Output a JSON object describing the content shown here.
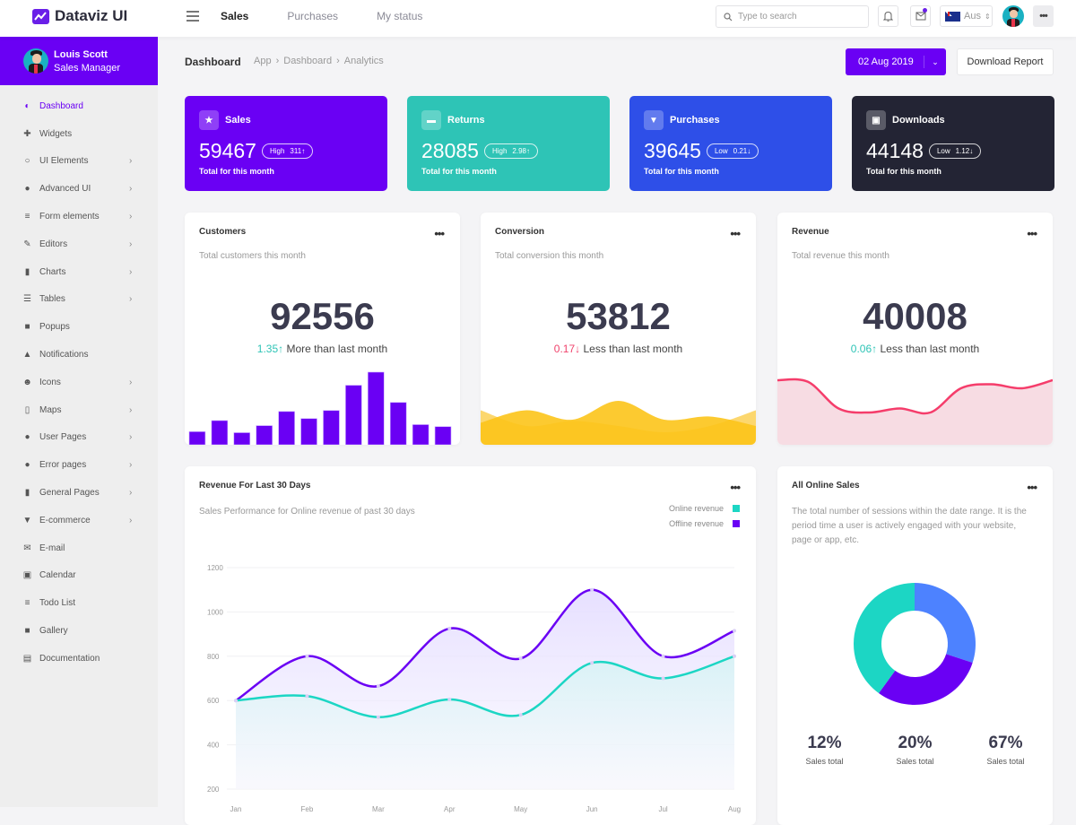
{
  "app": {
    "name": "Dataviz UI"
  },
  "topnav": {
    "tabs": [
      {
        "label": "Sales",
        "active": true
      },
      {
        "label": "Purchases"
      },
      {
        "label": "My status"
      }
    ],
    "search_placeholder": "Type to search",
    "language": "Aus",
    "notification_dot_color": "#6a1fe8"
  },
  "user": {
    "name": "Louis Scott",
    "role": "Sales Manager"
  },
  "sidebar": {
    "items": [
      {
        "label": "Dashboard",
        "icon": "shield-icon",
        "glyph": "◐",
        "active": true,
        "chevron": false
      },
      {
        "label": "Widgets",
        "icon": "puzzle-icon",
        "glyph": "✚",
        "chevron": false
      },
      {
        "label": "UI Elements",
        "icon": "circle-icon",
        "glyph": "○",
        "chevron": true
      },
      {
        "label": "Advanced UI",
        "icon": "palette-icon",
        "glyph": "●",
        "chevron": true
      },
      {
        "label": "Form elements",
        "icon": "list-icon",
        "glyph": "≡",
        "chevron": true
      },
      {
        "label": "Editors",
        "icon": "pencil-icon",
        "glyph": "✎",
        "chevron": true
      },
      {
        "label": "Charts",
        "icon": "bar-chart-icon",
        "glyph": "▮",
        "chevron": true
      },
      {
        "label": "Tables",
        "icon": "table-icon",
        "glyph": "☰",
        "chevron": true
      },
      {
        "label": "Popups",
        "icon": "comment-icon",
        "glyph": "■",
        "chevron": false
      },
      {
        "label": "Notifications",
        "icon": "bell-icon",
        "glyph": "▲",
        "chevron": false
      },
      {
        "label": "Icons",
        "icon": "smiley-icon",
        "glyph": "☻",
        "chevron": true
      },
      {
        "label": "Maps",
        "icon": "map-icon",
        "glyph": "▯",
        "chevron": true
      },
      {
        "label": "User Pages",
        "icon": "user-circle-icon",
        "glyph": "●",
        "chevron": true
      },
      {
        "label": "Error pages",
        "icon": "alert-icon",
        "glyph": "●",
        "chevron": true
      },
      {
        "label": "General Pages",
        "icon": "file-icon",
        "glyph": "▮",
        "chevron": true
      },
      {
        "label": "E-commerce",
        "icon": "basket-icon",
        "glyph": "▼",
        "chevron": true
      },
      {
        "label": "E-mail",
        "icon": "mail-icon",
        "glyph": "✉",
        "chevron": false
      },
      {
        "label": "Calendar",
        "icon": "calendar-icon",
        "glyph": "▣",
        "chevron": false
      },
      {
        "label": "Todo List",
        "icon": "checklist-icon",
        "glyph": "≡",
        "chevron": false
      },
      {
        "label": "Gallery",
        "icon": "image-icon",
        "glyph": "■",
        "chevron": false
      },
      {
        "label": "Documentation",
        "icon": "document-icon",
        "glyph": "▤",
        "chevron": false
      }
    ]
  },
  "header": {
    "title": "Dashboard",
    "breadcrumb": [
      "App",
      "Dashboard",
      "Analytics"
    ],
    "date": "02 Aug 2019",
    "download_label": "Download Report"
  },
  "stats": [
    {
      "label": "Sales",
      "value": "59467",
      "level": "High",
      "change": "311",
      "dir": "↑",
      "sub": "Total for this month",
      "color": "#6a00f4",
      "icon": "star-icon"
    },
    {
      "label": "Returns",
      "value": "28085",
      "level": "High",
      "change": "2.98",
      "dir": "↑",
      "sub": "Total for this month",
      "color": "#2ec4b6",
      "icon": "truck-icon"
    },
    {
      "label": "Purchases",
      "value": "39645",
      "level": "Low",
      "change": "0.21",
      "dir": "↓",
      "sub": "Total for this month",
      "color": "#2e4fe8",
      "icon": "basket-icon"
    },
    {
      "label": "Downloads",
      "value": "44148",
      "level": "Low",
      "change": "1.12",
      "dir": "↓",
      "sub": "Total for this month",
      "color": "#232434",
      "icon": "archive-icon"
    }
  ],
  "kpis": [
    {
      "title": "Customers",
      "subtitle": "Total customers this month",
      "value": "92556",
      "delta": "1.35",
      "dir": "↑",
      "trend": "up",
      "note": "More than last month"
    },
    {
      "title": "Conversion",
      "subtitle": "Total conversion this month",
      "value": "53812",
      "delta": "0.17",
      "dir": "↓",
      "trend": "down",
      "note": "Less than last month"
    },
    {
      "title": "Revenue",
      "subtitle": "Total revenue this month",
      "value": "40008",
      "delta": "0.06",
      "dir": "↑",
      "trend": "up",
      "note": "Less than last month"
    }
  ],
  "revenue_card": {
    "title": "Revenue For Last 30 Days",
    "subtitle": "Sales Performance for Online revenue of past 30 days"
  },
  "online_sales": {
    "title": "All Online Sales",
    "description": "The total number of sessions within the date range. It is the period time a user is actively engaged with your website, page or app, etc.",
    "stats": [
      {
        "value": "12%",
        "label": "Sales total"
      },
      {
        "value": "20%",
        "label": "Sales total"
      },
      {
        "value": "67%",
        "label": "Sales total"
      }
    ]
  },
  "chart_data": [
    {
      "type": "bar",
      "title": "Customers",
      "categories": [
        "1",
        "2",
        "3",
        "4",
        "5",
        "6",
        "7",
        "8",
        "9",
        "10",
        "11",
        "12"
      ],
      "values": [
        13,
        24,
        12,
        19,
        33,
        26,
        34,
        59,
        72,
        42,
        20,
        18
      ],
      "ylim": [
        0,
        80
      ],
      "color": "#6a00f4"
    },
    {
      "type": "area",
      "title": "Conversion",
      "series": [
        {
          "name": "back",
          "values": [
            55,
            30,
            38,
            30,
            20,
            30,
            55
          ],
          "color": "#fcd055"
        },
        {
          "name": "front",
          "values": [
            35,
            55,
            40,
            70,
            40,
            45,
            30
          ],
          "color": "#fcc419"
        }
      ],
      "ylim": [
        0,
        100
      ]
    },
    {
      "type": "area",
      "title": "Revenue",
      "series": [
        {
          "name": "revenue",
          "values": [
            80,
            78,
            45,
            40,
            45,
            40,
            70,
            75,
            70,
            80
          ],
          "color": "#f53d6b",
          "fill": "#f7dce3"
        }
      ],
      "ylim": [
        0,
        100
      ]
    },
    {
      "type": "line",
      "title": "Revenue For Last 30 Days",
      "categories": [
        "Jan",
        "Feb",
        "Mar",
        "Apr",
        "May",
        "Jun",
        "Jul",
        "Aug"
      ],
      "series": [
        {
          "name": "Online revenue",
          "values": [
            600,
            620,
            525,
            605,
            535,
            770,
            700,
            800
          ],
          "color": "#1cd6c4"
        },
        {
          "name": "Offline revenue",
          "values": [
            600,
            800,
            665,
            925,
            790,
            1100,
            800,
            915
          ],
          "color": "#6a00f4"
        }
      ],
      "yticks": [
        1200,
        1000,
        800,
        600,
        400,
        200
      ],
      "ylim": [
        200,
        1200
      ],
      "grid": true,
      "legend": "top-right"
    },
    {
      "type": "pie",
      "title": "All Online Sales",
      "labels": [
        "Blue segment",
        "Purple segment",
        "Teal segment"
      ],
      "values": [
        30,
        30,
        40
      ],
      "colors": [
        "#4d82ff",
        "#6a00f4",
        "#1cd6c4"
      ],
      "donut": true
    }
  ]
}
